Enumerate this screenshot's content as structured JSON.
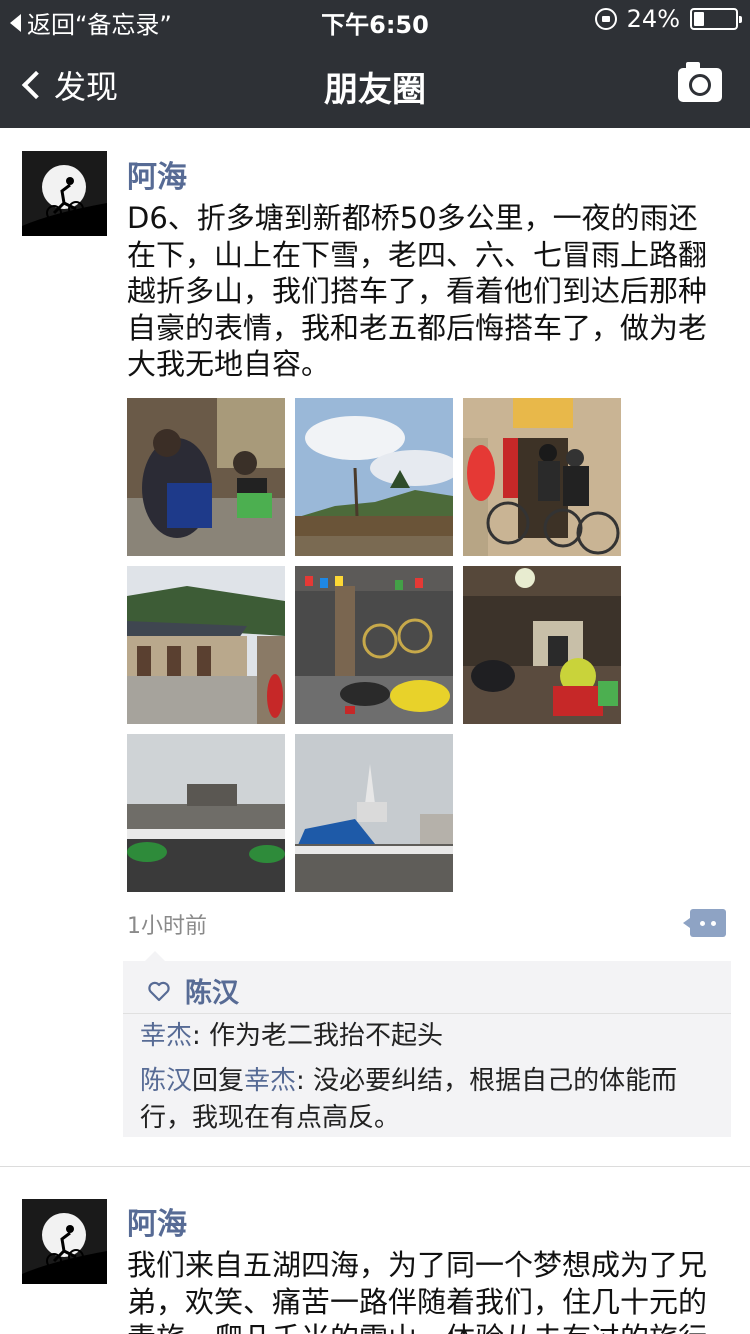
{
  "status_bar": {
    "back_label": "返回“备忘录”",
    "time": "下午6:50",
    "battery_text": "24%",
    "battery_level": 0.24
  },
  "nav": {
    "back_label": "发现",
    "title": "朋友圈"
  },
  "posts": [
    {
      "author": "阿海",
      "text_lines": [
        "D6、折多塘到新都桥50多公里，一夜的雨还",
        "在下，山上在下雪，老四、六、七冒雨上路翻",
        "越折多山，我们搭车了，看着他们到达后那种",
        "自豪的表情，我和老五都后悔搭车了，做为老",
        "大我无地自容。"
      ],
      "photo_count": 8,
      "time": "1小时前",
      "likes": [
        "陈汉"
      ],
      "comments": [
        {
          "name": "幸杰",
          "text": ": 作为老二我抬不起头"
        },
        {
          "name": "陈汉",
          "reply_word": "回复",
          "reply_to": "幸杰",
          "text_line1": ": 没必要纠结，根据自己的体能而",
          "text_line2": "行，我现在有点高反。"
        }
      ]
    },
    {
      "author": "阿海",
      "text_lines": [
        "我们来自五湖四海，为了同一个梦想成为了兄",
        "弟，欢笑、痛苦一路伴随着我们，住几十元的",
        "青旅，爬几千米的雪山，体验从未有过的旅行"
      ]
    }
  ],
  "colors": {
    "bar_bg": "#2e3136",
    "name_blue": "#576b95",
    "comment_bg": "#f3f3f5"
  }
}
